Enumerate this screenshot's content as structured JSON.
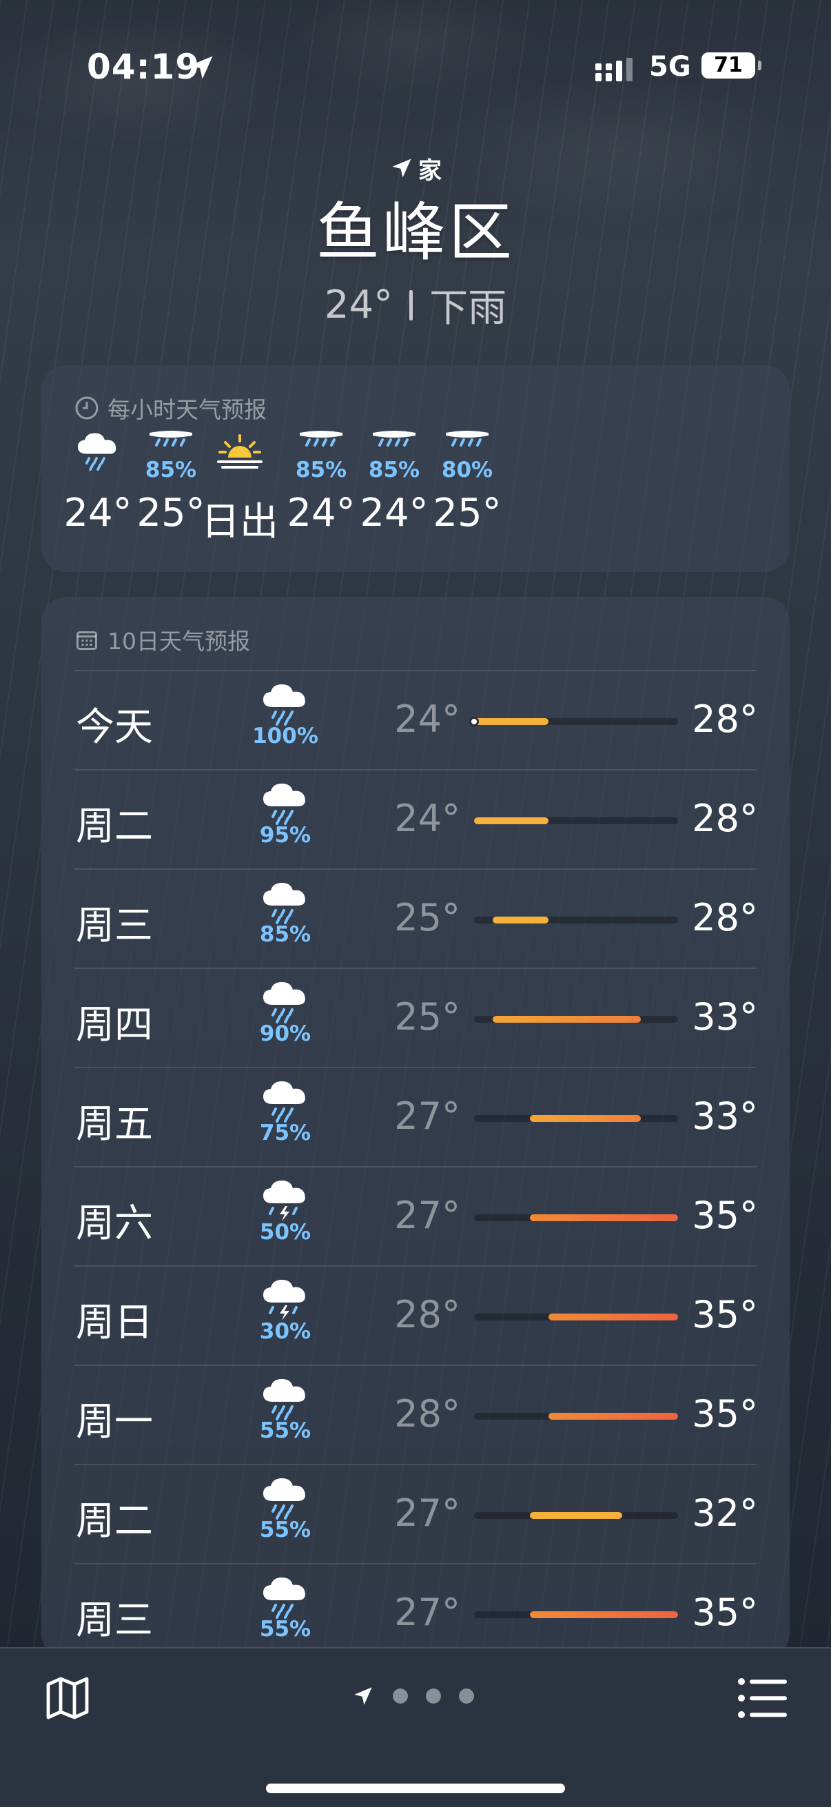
{
  "status_bar": {
    "time": "04:19",
    "network": "5G",
    "battery": "71"
  },
  "header": {
    "location_label": "家",
    "city": "鱼峰区",
    "temperature": "24°",
    "condition": "下雨"
  },
  "hourly": {
    "title": "每小时天气预报",
    "items": [
      {
        "icon": "cloud-rain-icon",
        "pct": "",
        "temp": "24°"
      },
      {
        "icon": "rain-icon",
        "pct": "85%",
        "temp": "25°"
      },
      {
        "icon": "sunrise-icon",
        "pct": "",
        "temp": "日出"
      },
      {
        "icon": "rain-icon",
        "pct": "85%",
        "temp": "24°"
      },
      {
        "icon": "rain-icon",
        "pct": "85%",
        "temp": "24°"
      },
      {
        "icon": "rain-icon",
        "pct": "80%",
        "temp": "25°"
      }
    ]
  },
  "daily": {
    "title": "10日天气预报",
    "range_min": 24,
    "range_max": 35,
    "days": [
      {
        "day": "今天",
        "icon": "cloud-rain-icon",
        "pct": "100%",
        "low": "24°",
        "high": "28°",
        "lo": 24,
        "hi": 28,
        "current": 24
      },
      {
        "day": "周二",
        "icon": "cloud-rain-icon",
        "pct": "95%",
        "low": "24°",
        "high": "28°",
        "lo": 24,
        "hi": 28
      },
      {
        "day": "周三",
        "icon": "cloud-rain-icon",
        "pct": "85%",
        "low": "25°",
        "high": "28°",
        "lo": 25,
        "hi": 28
      },
      {
        "day": "周四",
        "icon": "cloud-rain-icon",
        "pct": "90%",
        "low": "25°",
        "high": "33°",
        "lo": 25,
        "hi": 33
      },
      {
        "day": "周五",
        "icon": "cloud-rain-icon",
        "pct": "75%",
        "low": "27°",
        "high": "33°",
        "lo": 27,
        "hi": 33
      },
      {
        "day": "周六",
        "icon": "thunderstorm-icon",
        "pct": "50%",
        "low": "27°",
        "high": "35°",
        "lo": 27,
        "hi": 35
      },
      {
        "day": "周日",
        "icon": "thunderstorm-icon",
        "pct": "30%",
        "low": "28°",
        "high": "35°",
        "lo": 28,
        "hi": 35
      },
      {
        "day": "周一",
        "icon": "cloud-rain-icon",
        "pct": "55%",
        "low": "28°",
        "high": "35°",
        "lo": 28,
        "hi": 35
      },
      {
        "day": "周二",
        "icon": "cloud-rain-icon",
        "pct": "55%",
        "low": "27°",
        "high": "32°",
        "lo": 27,
        "hi": 32
      },
      {
        "day": "周三",
        "icon": "cloud-rain-icon",
        "pct": "55%",
        "low": "27°",
        "high": "35°",
        "lo": 27,
        "hi": 35
      }
    ]
  },
  "colors": {
    "rain_pct": "#7cc4ff",
    "bar_warm": "#f5b13a",
    "bar_hot": "#ef6a3c"
  }
}
